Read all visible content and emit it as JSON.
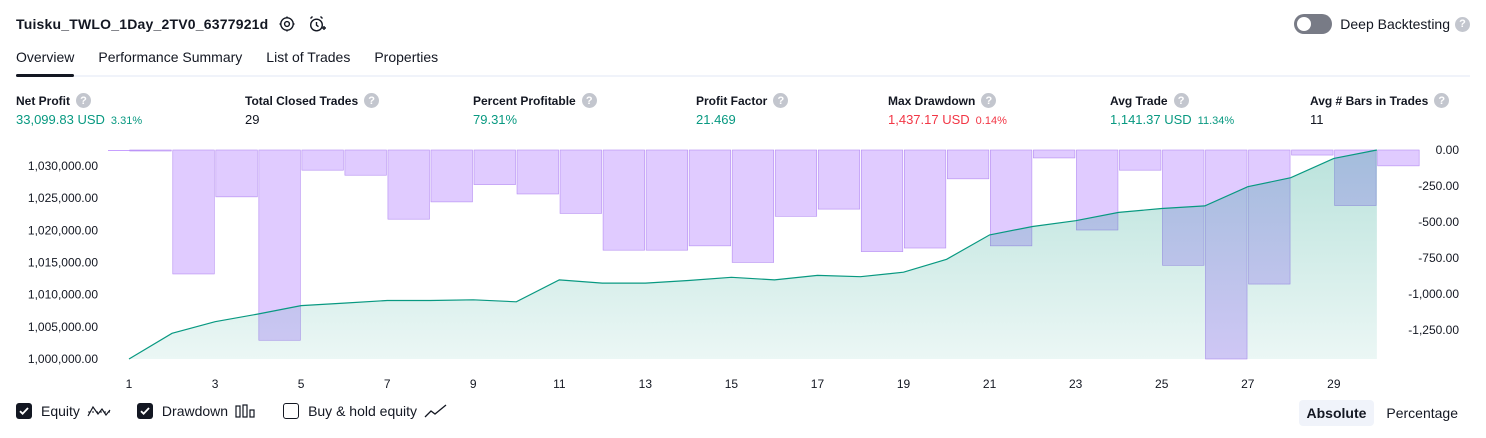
{
  "header": {
    "strategy_name": "Tuisku_TWLO_1Day_2TV0_6377921d",
    "settings_icon": "gear-icon",
    "alert_icon": "alarm-clock-add-icon",
    "deep_backtesting_label": "Deep Backtesting",
    "deep_backtesting_enabled": false,
    "help_glyph": "?"
  },
  "tabs": [
    {
      "label": "Overview",
      "active": true
    },
    {
      "label": "Performance Summary",
      "active": false
    },
    {
      "label": "List of Trades",
      "active": false
    },
    {
      "label": "Properties",
      "active": false
    }
  ],
  "metrics": [
    {
      "label": "Net Profit",
      "value": "33,099.83 USD",
      "pct": "3.31%",
      "tone": "pos"
    },
    {
      "label": "Total Closed Trades",
      "value": "29",
      "pct": "",
      "tone": "neutral"
    },
    {
      "label": "Percent Profitable",
      "value": "79.31%",
      "pct": "",
      "tone": "pos"
    },
    {
      "label": "Profit Factor",
      "value": "21.469",
      "pct": "",
      "tone": "pos"
    },
    {
      "label": "Max Drawdown",
      "value": "1,437.17 USD",
      "pct": "0.14%",
      "tone": "neg"
    },
    {
      "label": "Avg Trade",
      "value": "1,141.37 USD",
      "pct": "11.34%",
      "tone": "pos"
    },
    {
      "label": "Avg # Bars in Trades",
      "value": "11",
      "pct": "",
      "tone": "neutral"
    }
  ],
  "chart_data": {
    "type": "line",
    "x": [
      1,
      2,
      3,
      4,
      5,
      6,
      7,
      8,
      9,
      10,
      11,
      12,
      13,
      14,
      15,
      16,
      17,
      18,
      19,
      20,
      21,
      22,
      23,
      24,
      25,
      26,
      27,
      28,
      29,
      30
    ],
    "x_tick_labels": [
      "1",
      "3",
      "5",
      "7",
      "9",
      "11",
      "13",
      "15",
      "17",
      "19",
      "21",
      "23",
      "25",
      "27",
      "29"
    ],
    "left_axis": {
      "ticks": [
        "1,000,000.00",
        "1,005,000.00",
        "1,010,000.00",
        "1,015,000.00",
        "1,020,000.00",
        "1,025,000.00",
        "1,030,000.00"
      ],
      "ylim": [
        1000000,
        1032500
      ]
    },
    "right_axis": {
      "ticks": [
        "0.00",
        "-250.00",
        "-500.00",
        "-750.00",
        "-1,000.00",
        "-1,250.00"
      ],
      "ylim": [
        -1450,
        0
      ]
    },
    "series": [
      {
        "name": "Equity",
        "axis": "left",
        "color": "#089981",
        "values": [
          1000000,
          1004000,
          1005800,
          1007000,
          1008300,
          1008700,
          1009100,
          1009100,
          1009200,
          1008900,
          1012300,
          1011800,
          1011800,
          1012200,
          1012700,
          1012300,
          1013000,
          1012800,
          1013500,
          1015500,
          1019300,
          1020600,
          1021500,
          1022800,
          1023400,
          1023800,
          1026800,
          1028200,
          1031200,
          1032500
        ]
      },
      {
        "name": "Drawdown",
        "axis": "right",
        "color": "#c7a0ff",
        "values": [
          -5,
          -860,
          -325,
          -1320,
          -140,
          -175,
          -480,
          -360,
          -240,
          -305,
          -440,
          -695,
          -695,
          -665,
          -780,
          -460,
          -410,
          -705,
          -680,
          -200,
          -665,
          -55,
          -555,
          -140,
          -800,
          -1450,
          -930,
          -35,
          -385,
          -110
        ]
      }
    ]
  },
  "legend": [
    {
      "label": "Equity",
      "checked": true,
      "icon": "equity-line-icon"
    },
    {
      "label": "Drawdown",
      "checked": true,
      "icon": "drawdown-bars-icon"
    },
    {
      "label": "Buy & hold equity",
      "checked": false,
      "icon": "buy-hold-line-icon"
    }
  ],
  "modes": [
    {
      "label": "Absolute",
      "active": true
    },
    {
      "label": "Percentage",
      "active": false
    }
  ]
}
